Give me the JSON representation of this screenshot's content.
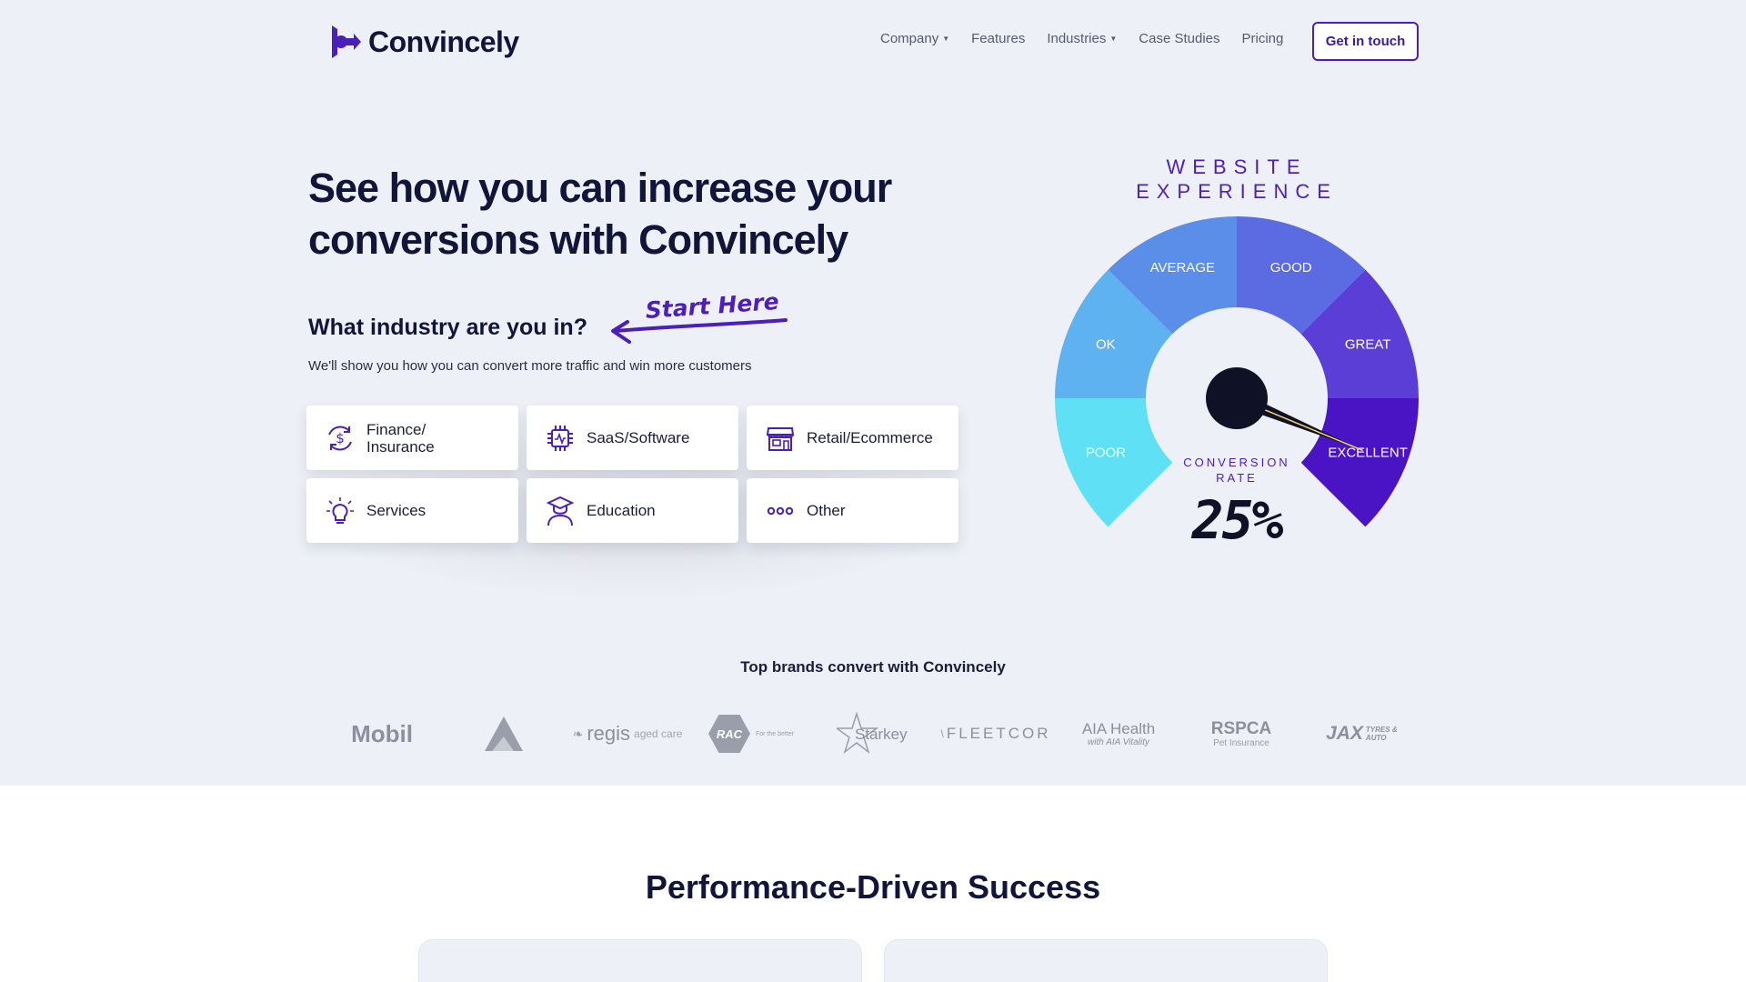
{
  "brand": {
    "name": "Convincely",
    "accent": "#4b1fb8"
  },
  "nav": {
    "items": [
      {
        "label": "Company",
        "dropdown": true
      },
      {
        "label": "Features",
        "dropdown": false
      },
      {
        "label": "Industries",
        "dropdown": true
      },
      {
        "label": "Case Studies",
        "dropdown": false
      },
      {
        "label": "Pricing",
        "dropdown": false
      }
    ],
    "cta_label": "Get in touch"
  },
  "hero": {
    "title_line1": "See how you can increase your",
    "title_line2": "conversions with Convincely",
    "question": "What industry are you in?",
    "annotation": "Start Here",
    "subtext": "We'll show you how you can convert more traffic and win more customers"
  },
  "industries": [
    {
      "label_line1": "Finance/",
      "label_line2": "Insurance",
      "icon": "dollar-refresh-icon"
    },
    {
      "label_line1": "SaaS/Software",
      "label_line2": "",
      "icon": "chip-icon"
    },
    {
      "label_line1": "Retail/Ecommerce",
      "label_line2": "",
      "icon": "storefront-icon"
    },
    {
      "label_line1": "Services",
      "label_line2": "",
      "icon": "lightbulb-icon"
    },
    {
      "label_line1": "Education",
      "label_line2": "",
      "icon": "graduate-icon"
    },
    {
      "label_line1": "Other",
      "label_line2": "",
      "icon": "dots-icon"
    }
  ],
  "gauge": {
    "title_line1": "WEBSITE",
    "title_line2": "EXPERIENCE",
    "segments": [
      {
        "label": "POOR",
        "color": "#5fe0f5"
      },
      {
        "label": "OK",
        "color": "#5eb2ef"
      },
      {
        "label": "AVERAGE",
        "color": "#5b8ee8"
      },
      {
        "label": "GOOD",
        "color": "#5b6be2"
      },
      {
        "label": "GREAT",
        "color": "#5a3ed6"
      },
      {
        "label": "EXCELLENT",
        "color": "#4a14c4"
      }
    ],
    "needle_level": "EXCELLENT",
    "conversion_label_line1": "CONVERSION",
    "conversion_label_line2": "RATE",
    "conversion_value": "25%"
  },
  "brands": {
    "title": "Top brands convert with Convincely",
    "logos": [
      {
        "text": "Mobil"
      },
      {
        "text": ""
      },
      {
        "text": "regis",
        "sub": "aged care"
      },
      {
        "text": "RAC",
        "sub": "For the better"
      },
      {
        "text": "Starkey"
      },
      {
        "text": "FLEETCOR"
      },
      {
        "text": "AIA Health",
        "sub": "with AIA Vitality"
      },
      {
        "text": "RSPCA",
        "sub": "Pet Insurance"
      },
      {
        "text": "JAX",
        "sub": "TYRES & AUTO"
      }
    ]
  },
  "performance": {
    "title": "Performance-Driven Success"
  }
}
